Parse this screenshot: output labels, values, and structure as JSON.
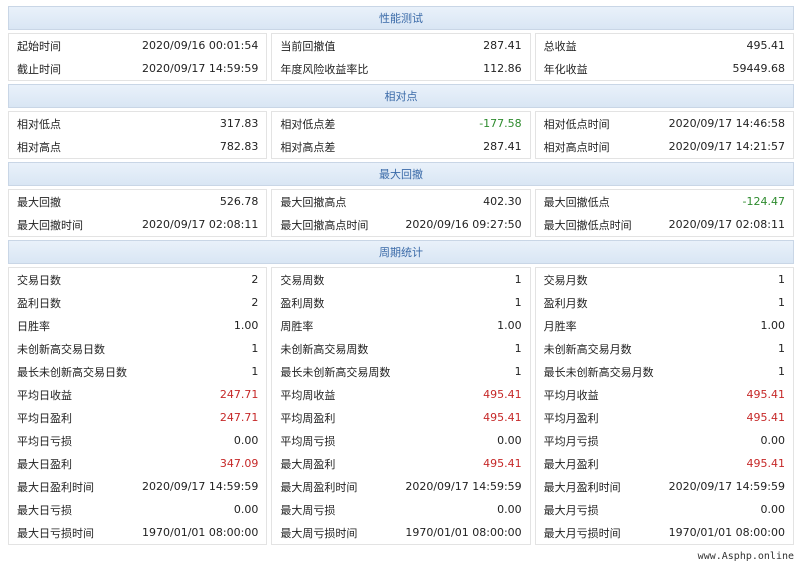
{
  "sections": [
    {
      "title": "性能测试",
      "columns": [
        [
          {
            "label": "起始时间",
            "value": "2020/09/16 00:01:54"
          },
          {
            "label": "截止时间",
            "value": "2020/09/17 14:59:59"
          }
        ],
        [
          {
            "label": "当前回撤值",
            "value": "287.41"
          },
          {
            "label": "年度风险收益率比",
            "value": "112.86"
          }
        ],
        [
          {
            "label": "总收益",
            "value": "495.41"
          },
          {
            "label": "年化收益",
            "value": "59449.68"
          }
        ]
      ]
    },
    {
      "title": "相对点",
      "columns": [
        [
          {
            "label": "相对低点",
            "value": "317.83"
          },
          {
            "label": "相对高点",
            "value": "782.83"
          }
        ],
        [
          {
            "label": "相对低点差",
            "value": "-177.58",
            "tone": "neg"
          },
          {
            "label": "相对高点差",
            "value": "287.41"
          }
        ],
        [
          {
            "label": "相对低点时间",
            "value": "2020/09/17 14:46:58"
          },
          {
            "label": "相对高点时间",
            "value": "2020/09/17 14:21:57"
          }
        ]
      ]
    },
    {
      "title": "最大回撤",
      "columns": [
        [
          {
            "label": "最大回撤",
            "value": "526.78"
          },
          {
            "label": "最大回撤时间",
            "value": "2020/09/17 02:08:11"
          }
        ],
        [
          {
            "label": "最大回撤高点",
            "value": "402.30"
          },
          {
            "label": "最大回撤高点时间",
            "value": "2020/09/16 09:27:50"
          }
        ],
        [
          {
            "label": "最大回撤低点",
            "value": "-124.47",
            "tone": "neg"
          },
          {
            "label": "最大回撤低点时间",
            "value": "2020/09/17 02:08:11"
          }
        ]
      ]
    },
    {
      "title": "周期统计",
      "columns": [
        [
          {
            "label": "交易日数",
            "value": "2"
          },
          {
            "label": "盈利日数",
            "value": "2"
          },
          {
            "label": "日胜率",
            "value": "1.00"
          },
          {
            "label": "未创新高交易日数",
            "value": "1"
          },
          {
            "label": "最长未创新高交易日数",
            "value": "1"
          },
          {
            "label": "平均日收益",
            "value": "247.71",
            "tone": "pos"
          },
          {
            "label": "平均日盈利",
            "value": "247.71",
            "tone": "pos"
          },
          {
            "label": "平均日亏损",
            "value": "0.00"
          },
          {
            "label": "最大日盈利",
            "value": "347.09",
            "tone": "pos"
          },
          {
            "label": "最大日盈利时间",
            "value": "2020/09/17 14:59:59"
          },
          {
            "label": "最大日亏损",
            "value": "0.00"
          },
          {
            "label": "最大日亏损时间",
            "value": "1970/01/01 08:00:00"
          }
        ],
        [
          {
            "label": "交易周数",
            "value": "1"
          },
          {
            "label": "盈利周数",
            "value": "1"
          },
          {
            "label": "周胜率",
            "value": "1.00"
          },
          {
            "label": "未创新高交易周数",
            "value": "1"
          },
          {
            "label": "最长未创新高交易周数",
            "value": "1"
          },
          {
            "label": "平均周收益",
            "value": "495.41",
            "tone": "pos"
          },
          {
            "label": "平均周盈利",
            "value": "495.41",
            "tone": "pos"
          },
          {
            "label": "平均周亏损",
            "value": "0.00"
          },
          {
            "label": "最大周盈利",
            "value": "495.41",
            "tone": "pos"
          },
          {
            "label": "最大周盈利时间",
            "value": "2020/09/17 14:59:59"
          },
          {
            "label": "最大周亏损",
            "value": "0.00"
          },
          {
            "label": "最大周亏损时间",
            "value": "1970/01/01 08:00:00"
          }
        ],
        [
          {
            "label": "交易月数",
            "value": "1"
          },
          {
            "label": "盈利月数",
            "value": "1"
          },
          {
            "label": "月胜率",
            "value": "1.00"
          },
          {
            "label": "未创新高交易月数",
            "value": "1"
          },
          {
            "label": "最长未创新高交易月数",
            "value": "1"
          },
          {
            "label": "平均月收益",
            "value": "495.41",
            "tone": "pos"
          },
          {
            "label": "平均月盈利",
            "value": "495.41",
            "tone": "pos"
          },
          {
            "label": "平均月亏损",
            "value": "0.00"
          },
          {
            "label": "最大月盈利",
            "value": "495.41",
            "tone": "pos"
          },
          {
            "label": "最大月盈利时间",
            "value": "2020/09/17 14:59:59"
          },
          {
            "label": "最大月亏损",
            "value": "0.00"
          },
          {
            "label": "最大月亏损时间",
            "value": "1970/01/01 08:00:00"
          }
        ]
      ]
    }
  ],
  "watermark": "www.Asphp.online",
  "colors": {
    "positive": "#c62828",
    "negative": "#2e8b2e",
    "header_text": "#3a6aa8"
  }
}
